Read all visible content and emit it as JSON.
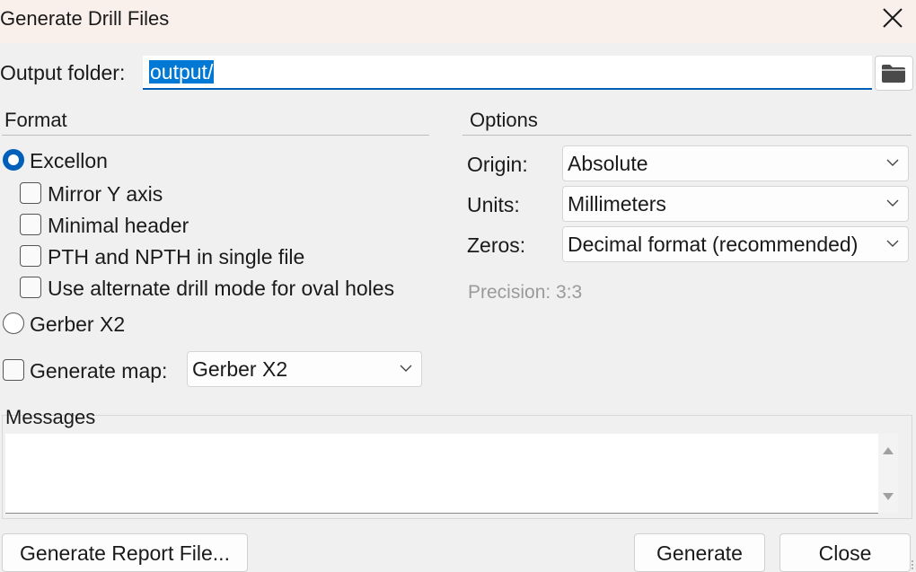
{
  "window": {
    "title": "Generate Drill Files",
    "close_icon": "close-icon"
  },
  "output": {
    "label": "Output folder:",
    "value": "output/",
    "browse_icon": "folder-icon"
  },
  "format": {
    "heading": "Format",
    "excellon_label": "Excellon",
    "excellon_selected": true,
    "options": [
      {
        "label": "Mirror Y axis",
        "checked": false
      },
      {
        "label": "Minimal header",
        "checked": false
      },
      {
        "label": "PTH and NPTH in single file",
        "checked": false
      },
      {
        "label": "Use alternate drill mode for oval holes",
        "checked": false
      }
    ],
    "gerber_label": "Gerber X2",
    "gerber_selected": false
  },
  "map": {
    "label": "Generate map:",
    "checked": false,
    "value": "Gerber X2"
  },
  "options": {
    "heading": "Options",
    "origin_label": "Origin:",
    "origin_value": "Absolute",
    "units_label": "Units:",
    "units_value": "Millimeters",
    "zeros_label": "Zeros:",
    "zeros_value": "Decimal format (recommended)",
    "precision": "Precision: 3:3"
  },
  "messages": {
    "label": "Messages",
    "content": ""
  },
  "buttons": {
    "report": "Generate Report File...",
    "generate": "Generate",
    "close": "Close"
  },
  "colors": {
    "accent": "#005fb8",
    "selection": "#0078d4",
    "titlebar": "#f9f0ec",
    "background": "#f0f0f0"
  }
}
